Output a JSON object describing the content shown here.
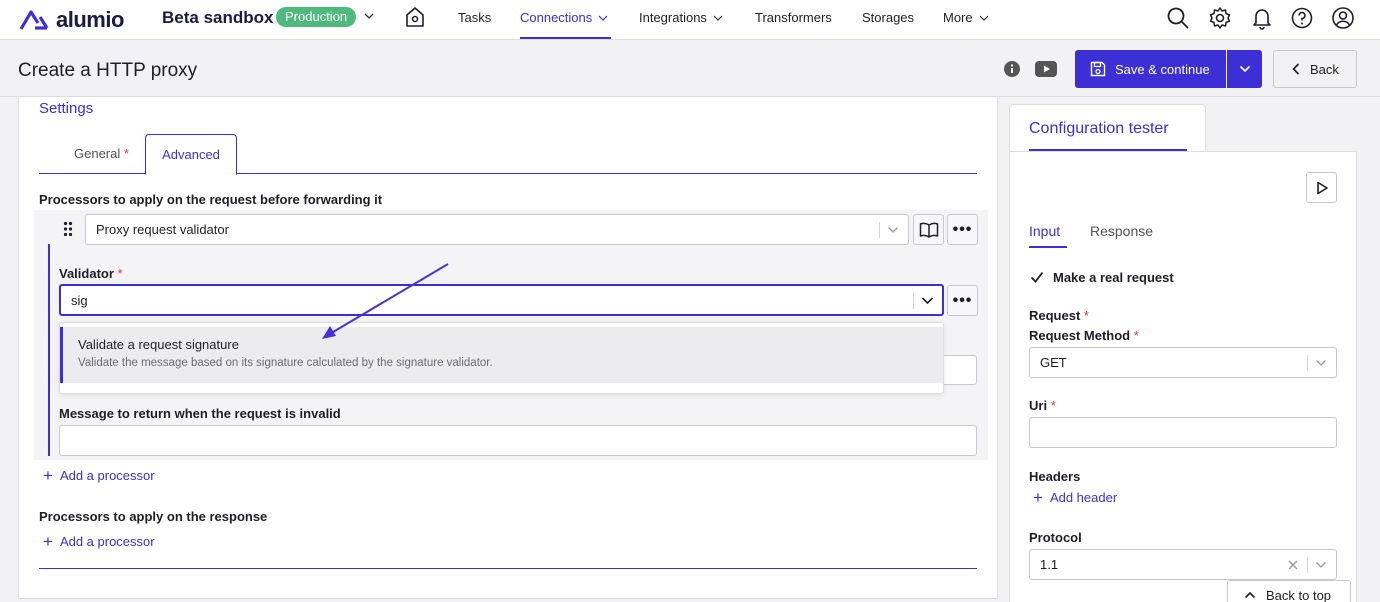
{
  "brand": {
    "logo_text": "alumio"
  },
  "environment": {
    "name": "Beta sandbox",
    "badge": "Production"
  },
  "nav": {
    "items": [
      {
        "label": "Tasks"
      },
      {
        "label": "Connections"
      },
      {
        "label": "Integrations"
      },
      {
        "label": "Transformers"
      },
      {
        "label": "Storages"
      },
      {
        "label": "More"
      }
    ]
  },
  "header": {
    "title": "Create a HTTP proxy",
    "save_label": "Save & continue",
    "back_label": "Back"
  },
  "settings": {
    "title": "Settings",
    "tabs": {
      "general": "General",
      "advanced": "Advanced"
    },
    "required_mark": "*",
    "request_processors_label": "Processors to apply on the request before forwarding it",
    "processor_select_value": "Proxy request validator",
    "validator_label": "Validator",
    "validator_input_value": "sig",
    "dropdown_option_title": "Validate a request signature",
    "dropdown_option_desc": "Validate the message based on its signature calculated by the signature validator.",
    "invalid_message_label": "Message to return when the request is invalid",
    "invalid_message_value": "",
    "add_processor_label": "Add a processor",
    "response_processors_label": "Processors to apply on the response",
    "add_processor_label_2": "Add a processor"
  },
  "tester": {
    "title": "Configuration tester",
    "tabs": {
      "input": "Input",
      "response": "Response"
    },
    "make_real_request_label": "Make a real request",
    "request_label": "Request",
    "request_method_label": "Request Method",
    "request_method_value": "GET",
    "uri_label": "Uri",
    "uri_value": "",
    "headers_label": "Headers",
    "add_header_label": "Add header",
    "protocol_label": "Protocol",
    "protocol_value": "1.1"
  },
  "back_to_top_label": "Back to top",
  "colors": {
    "accent": "#3c2fd6",
    "badge": "#4eba7d",
    "required": "#dd3333"
  }
}
